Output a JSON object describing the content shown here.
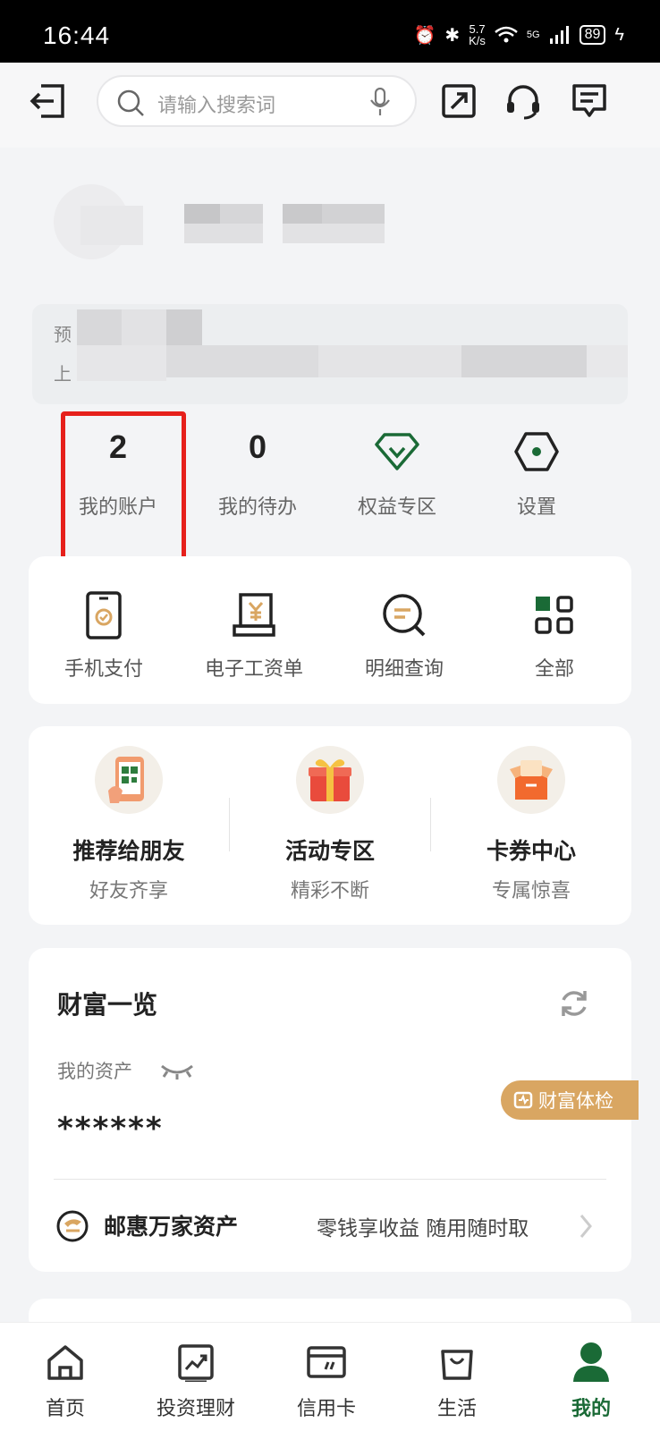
{
  "status_bar": {
    "time": "16:44",
    "speed_top": "5.7",
    "speed_bottom": "K/s",
    "network": "5G",
    "battery": "89"
  },
  "header": {
    "search_placeholder": "请输入搜索词"
  },
  "notice": {
    "line1_prefix": "预",
    "line2_prefix": "上"
  },
  "quick": {
    "accounts": {
      "value": "2",
      "label": "我的账户"
    },
    "todo": {
      "value": "0",
      "label": "我的待办"
    },
    "rights": {
      "label": "权益专区"
    },
    "settings": {
      "label": "设置"
    }
  },
  "services": [
    {
      "label": "手机支付"
    },
    {
      "label": "电子工资单"
    },
    {
      "label": "明细查询"
    },
    {
      "label": "全部"
    }
  ],
  "promos": [
    {
      "title": "推荐给朋友",
      "subtitle": "好友齐享"
    },
    {
      "title": "活动专区",
      "subtitle": "精彩不断"
    },
    {
      "title": "卡券中心",
      "subtitle": "专属惊喜"
    }
  ],
  "wealth": {
    "title": "财富一览",
    "assets_label": "我的资产",
    "assets_value": "******",
    "checkup": "财富体检"
  },
  "youhui": {
    "name": "邮惠万家资产",
    "desc": "零钱享收益 随用随时取"
  },
  "tabs": [
    {
      "label": "首页"
    },
    {
      "label": "投资理财"
    },
    {
      "label": "信用卡"
    },
    {
      "label": "生活"
    },
    {
      "label": "我的"
    }
  ],
  "colors": {
    "brand_green": "#1a6a36",
    "highlight_red": "#e6201b",
    "gold": "#d9a662"
  }
}
